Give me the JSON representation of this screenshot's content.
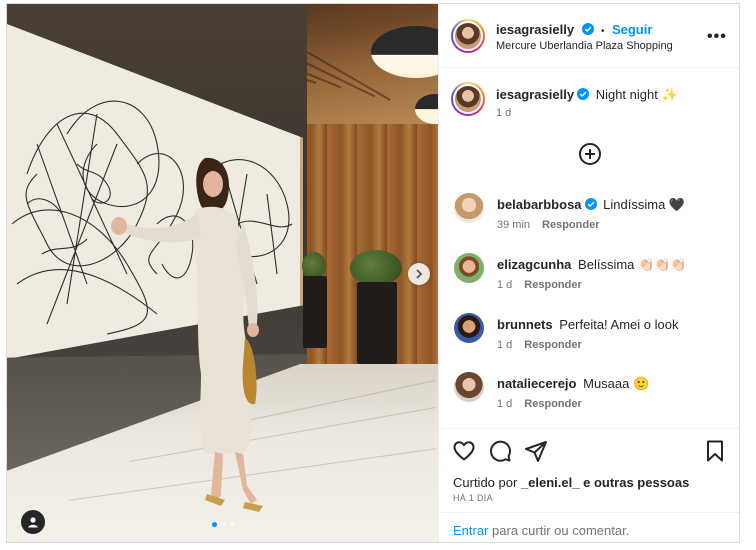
{
  "post": {
    "author": "iesagrasielly",
    "follow_label": "Seguir",
    "separator": "•",
    "location": "Mercure Uberlandia Plaza Shopping",
    "more_label": "•••",
    "caption": "Night night ✨",
    "caption_age": "1 d"
  },
  "comments": [
    {
      "user": "belabarbbosa",
      "verified": true,
      "text": "Lindíssima 🖤",
      "age": "39 min",
      "reply": "Responder"
    },
    {
      "user": "elizagcunha",
      "verified": false,
      "text": "Belíssima 👏🏻👏🏻👏🏻",
      "age": "1 d",
      "reply": "Responder"
    },
    {
      "user": "brunnets",
      "verified": false,
      "text": "Perfeita! Amei o look",
      "age": "1 d",
      "reply": "Responder"
    },
    {
      "user": "nataliecerejo",
      "verified": false,
      "text": "Musaaa 🙂",
      "age": "1 d",
      "reply": "Responder"
    }
  ],
  "likes": {
    "prefix": "Curtido por",
    "user": "_eleni.el_",
    "suffix": "e outras pessoas"
  },
  "time_ago": "HÁ 1 DIA",
  "login": {
    "link": "Entrar",
    "rest": "para curtir ou comentar."
  },
  "carousel": {
    "total": 3,
    "active": 1
  },
  "colors": {
    "accent": "#0095f6",
    "text": "#262626",
    "muted": "#737373",
    "border": "#dbdbdb"
  },
  "icons": [
    "verified-icon",
    "more-options-icon",
    "add-comment-icon",
    "heart-icon",
    "comment-icon",
    "share-icon",
    "bookmark-icon",
    "next-arrow-icon",
    "user-tag-icon"
  ]
}
